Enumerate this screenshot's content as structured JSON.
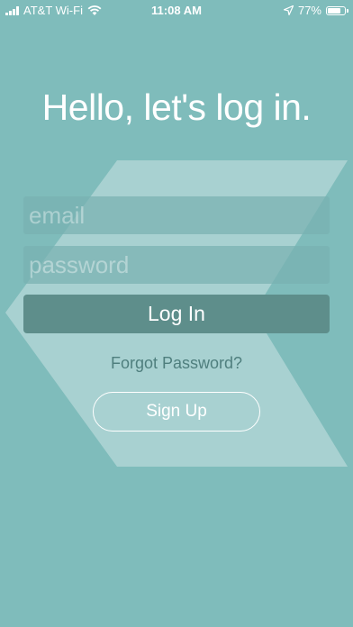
{
  "status_bar": {
    "carrier": "AT&T Wi-Fi",
    "time": "11:08 AM",
    "battery": "77%",
    "battery_level": 0.77,
    "signal_icon": "cellular-signal-icon",
    "wifi_icon": "wifi-icon",
    "location_icon": "location-arrow-icon",
    "battery_icon": "battery-icon"
  },
  "heading": "Hello, let's log in.",
  "form": {
    "email": {
      "placeholder": "email",
      "value": ""
    },
    "password": {
      "placeholder": "password",
      "value": ""
    },
    "login_label": "Log In",
    "forgot_label": "Forgot Password?",
    "signup_label": "Sign Up"
  },
  "colors": {
    "background": "#7fbcbb",
    "shape": "#a9d3d2",
    "field": "#78b2b2",
    "login_button": "#5e8e8b",
    "forgot_text": "#4f7f7e"
  }
}
